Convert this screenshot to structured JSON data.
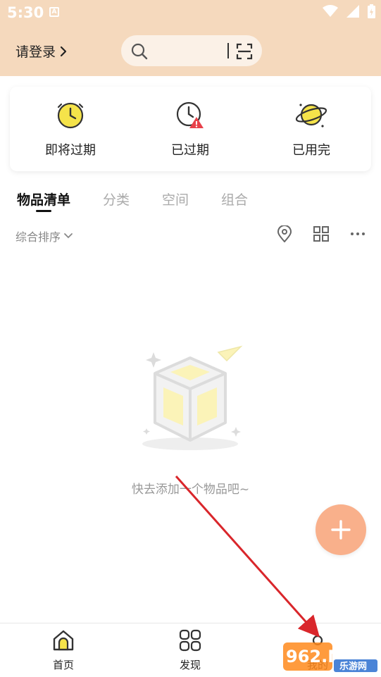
{
  "status_bar": {
    "time": "5:30",
    "notif_icon": "A"
  },
  "header": {
    "login_label": "请登录",
    "search_placeholder": ""
  },
  "status_card": {
    "items": [
      {
        "label": "即将过期",
        "icon": "clock-icon"
      },
      {
        "label": "已过期",
        "icon": "clock-warning-icon"
      },
      {
        "label": "已用完",
        "icon": "planet-icon"
      }
    ]
  },
  "tabs": [
    {
      "label": "物品清单",
      "active": true
    },
    {
      "label": "分类",
      "active": false
    },
    {
      "label": "空间",
      "active": false
    },
    {
      "label": "组合",
      "active": false
    }
  ],
  "sortbar": {
    "sort_label": "综合排序"
  },
  "empty_state": {
    "text": "快去添加一个物品吧~"
  },
  "bottom_nav": {
    "items": [
      {
        "label": "首页",
        "icon": "home-icon"
      },
      {
        "label": "发现",
        "icon": "grid-icon"
      },
      {
        "label": "我的",
        "icon": "profile-icon"
      }
    ]
  },
  "watermark": {
    "text_top": "962.NET",
    "text_bottom": "乐游网"
  },
  "colors": {
    "header_bg": "#f5d9bd",
    "accent_yellow": "#f5e34a",
    "fab": "#f9b08b",
    "annotation_arrow": "#d9262b"
  }
}
